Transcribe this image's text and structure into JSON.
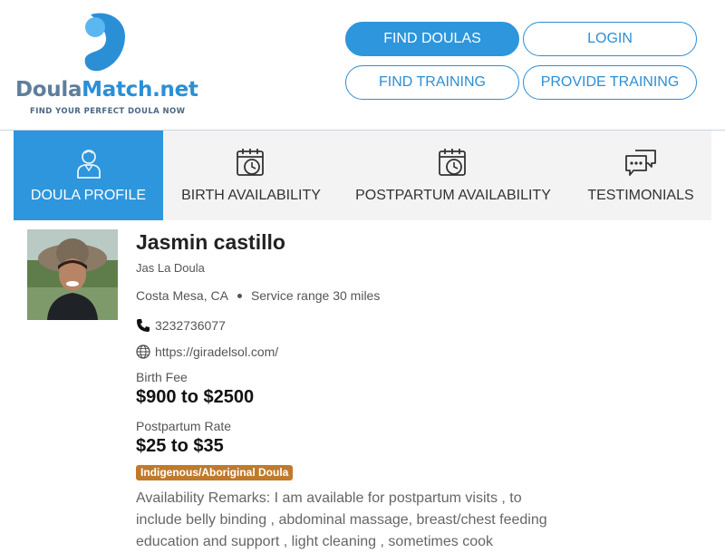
{
  "brand": {
    "name_part1": "Doula",
    "name_part2": "Match.net",
    "tagline": "FIND YOUR PERFECT DOULA NOW"
  },
  "nav": {
    "find_doulas": "FIND DOULAS",
    "login": "LOGIN",
    "find_training": "FIND TRAINING",
    "provide_training": "PROVIDE TRAINING"
  },
  "tabs": [
    {
      "label": "DOULA PROFILE",
      "icon": "user-icon",
      "active": true
    },
    {
      "label": "BIRTH AVAILABILITY",
      "icon": "calendar-clock-icon",
      "active": false
    },
    {
      "label": "POSTPARTUM AVAILABILITY",
      "icon": "calendar-clock-icon",
      "active": false
    },
    {
      "label": "TESTIMONIALS",
      "icon": "chat-bubbles-icon",
      "active": false
    }
  ],
  "profile": {
    "name": "Jasmin castillo",
    "business": "Jas La Doula",
    "city": "Costa Mesa, CA",
    "service_range": "Service range 30 miles",
    "phone": "3232736077",
    "website": "https://giradelsol.com/",
    "birth_fee_label": "Birth Fee",
    "birth_fee": "$900 to $2500",
    "postpartum_label": "Postpartum Rate",
    "postpartum_rate": "$25 to $35",
    "badge": "Indigenous/Aboriginal Doula",
    "remarks": "Availability Remarks: I am available for postpartum visits , to include belly binding , abdominal massage, breast/chest feeding education and support , light cleaning , sometimes cook"
  },
  "colors": {
    "accent": "#2d96dc",
    "badge": "#c07a2a",
    "tab_bg": "#f3f3f3"
  }
}
